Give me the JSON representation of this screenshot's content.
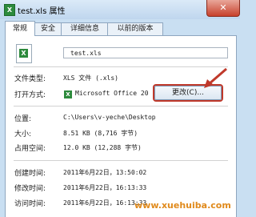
{
  "window": {
    "title": "test.xls 属性",
    "close_glyph": "✕",
    "icon_glyph": "X"
  },
  "tabs": [
    {
      "label": "常规",
      "active": true
    },
    {
      "label": "安全"
    },
    {
      "label": "详细信息"
    },
    {
      "label": "以前的版本"
    }
  ],
  "file": {
    "name": "test.xls"
  },
  "rows": {
    "type": {
      "label": "文件类型:",
      "value": "XLS 文件 (.xls)"
    },
    "opens_with": {
      "label": "打开方式:",
      "value": "Microsoft Office 20"
    },
    "location": {
      "label": "位置:",
      "value": "C:\\Users\\v-yeche\\Desktop"
    },
    "size": {
      "label": "大小:",
      "value": "8.51 KB (8,716 字节)"
    },
    "size_on_disk": {
      "label": "占用空间:",
      "value": "12.0 KB (12,288 字节)"
    },
    "created": {
      "label": "创建时间:",
      "value": "2011年6月22日，13:50:02"
    },
    "modified": {
      "label": "修改时间:",
      "value": "2011年6月22日，16:13:33"
    },
    "accessed": {
      "label": "访问时间:",
      "value": "2011年6月22日，16:13:33"
    }
  },
  "change_button": {
    "label": "更改(C)..."
  },
  "watermark": {
    "text": "www.xuehuiba.com"
  },
  "colors": {
    "highlight_red": "#c0392b",
    "excel_green": "#2c8a3c"
  }
}
